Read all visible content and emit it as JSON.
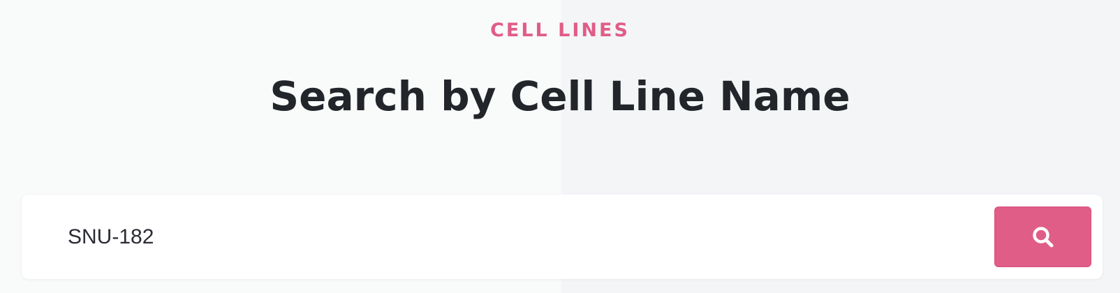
{
  "hero": {
    "eyebrow": "CELL LINES",
    "title": "Search by Cell Line Name"
  },
  "search": {
    "value": "SNU-182",
    "button_icon": "search-icon"
  },
  "colors": {
    "accent": "#e05d87",
    "title": "#22252a",
    "background_left": "#f9fafa",
    "background_right": "#f4f5f7"
  }
}
